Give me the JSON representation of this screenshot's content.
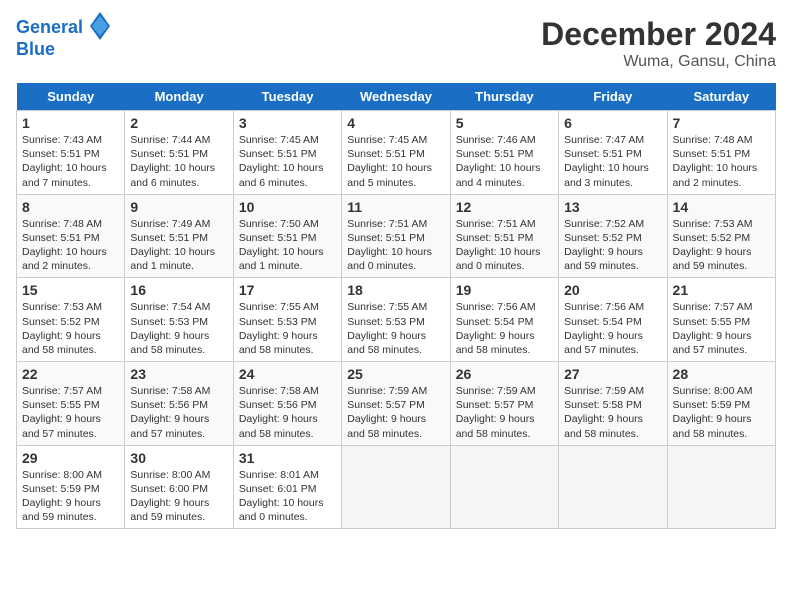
{
  "header": {
    "logo_line1": "General",
    "logo_line2": "Blue",
    "month": "December 2024",
    "location": "Wuma, Gansu, China"
  },
  "days_of_week": [
    "Sunday",
    "Monday",
    "Tuesday",
    "Wednesday",
    "Thursday",
    "Friday",
    "Saturday"
  ],
  "weeks": [
    [
      {
        "day": 1,
        "sunrise": "7:43 AM",
        "sunset": "5:51 PM",
        "daylight": "10 hours and 7 minutes."
      },
      {
        "day": 2,
        "sunrise": "7:44 AM",
        "sunset": "5:51 PM",
        "daylight": "10 hours and 6 minutes."
      },
      {
        "day": 3,
        "sunrise": "7:45 AM",
        "sunset": "5:51 PM",
        "daylight": "10 hours and 6 minutes."
      },
      {
        "day": 4,
        "sunrise": "7:45 AM",
        "sunset": "5:51 PM",
        "daylight": "10 hours and 5 minutes."
      },
      {
        "day": 5,
        "sunrise": "7:46 AM",
        "sunset": "5:51 PM",
        "daylight": "10 hours and 4 minutes."
      },
      {
        "day": 6,
        "sunrise": "7:47 AM",
        "sunset": "5:51 PM",
        "daylight": "10 hours and 3 minutes."
      },
      {
        "day": 7,
        "sunrise": "7:48 AM",
        "sunset": "5:51 PM",
        "daylight": "10 hours and 2 minutes."
      }
    ],
    [
      {
        "day": 8,
        "sunrise": "7:48 AM",
        "sunset": "5:51 PM",
        "daylight": "10 hours and 2 minutes."
      },
      {
        "day": 9,
        "sunrise": "7:49 AM",
        "sunset": "5:51 PM",
        "daylight": "10 hours and 1 minute."
      },
      {
        "day": 10,
        "sunrise": "7:50 AM",
        "sunset": "5:51 PM",
        "daylight": "10 hours and 1 minute."
      },
      {
        "day": 11,
        "sunrise": "7:51 AM",
        "sunset": "5:51 PM",
        "daylight": "10 hours and 0 minutes."
      },
      {
        "day": 12,
        "sunrise": "7:51 AM",
        "sunset": "5:51 PM",
        "daylight": "10 hours and 0 minutes."
      },
      {
        "day": 13,
        "sunrise": "7:52 AM",
        "sunset": "5:52 PM",
        "daylight": "9 hours and 59 minutes."
      },
      {
        "day": 14,
        "sunrise": "7:53 AM",
        "sunset": "5:52 PM",
        "daylight": "9 hours and 59 minutes."
      }
    ],
    [
      {
        "day": 15,
        "sunrise": "7:53 AM",
        "sunset": "5:52 PM",
        "daylight": "9 hours and 58 minutes."
      },
      {
        "day": 16,
        "sunrise": "7:54 AM",
        "sunset": "5:53 PM",
        "daylight": "9 hours and 58 minutes."
      },
      {
        "day": 17,
        "sunrise": "7:55 AM",
        "sunset": "5:53 PM",
        "daylight": "9 hours and 58 minutes."
      },
      {
        "day": 18,
        "sunrise": "7:55 AM",
        "sunset": "5:53 PM",
        "daylight": "9 hours and 58 minutes."
      },
      {
        "day": 19,
        "sunrise": "7:56 AM",
        "sunset": "5:54 PM",
        "daylight": "9 hours and 58 minutes."
      },
      {
        "day": 20,
        "sunrise": "7:56 AM",
        "sunset": "5:54 PM",
        "daylight": "9 hours and 57 minutes."
      },
      {
        "day": 21,
        "sunrise": "7:57 AM",
        "sunset": "5:55 PM",
        "daylight": "9 hours and 57 minutes."
      }
    ],
    [
      {
        "day": 22,
        "sunrise": "7:57 AM",
        "sunset": "5:55 PM",
        "daylight": "9 hours and 57 minutes."
      },
      {
        "day": 23,
        "sunrise": "7:58 AM",
        "sunset": "5:56 PM",
        "daylight": "9 hours and 57 minutes."
      },
      {
        "day": 24,
        "sunrise": "7:58 AM",
        "sunset": "5:56 PM",
        "daylight": "9 hours and 58 minutes."
      },
      {
        "day": 25,
        "sunrise": "7:59 AM",
        "sunset": "5:57 PM",
        "daylight": "9 hours and 58 minutes."
      },
      {
        "day": 26,
        "sunrise": "7:59 AM",
        "sunset": "5:57 PM",
        "daylight": "9 hours and 58 minutes."
      },
      {
        "day": 27,
        "sunrise": "7:59 AM",
        "sunset": "5:58 PM",
        "daylight": "9 hours and 58 minutes."
      },
      {
        "day": 28,
        "sunrise": "8:00 AM",
        "sunset": "5:59 PM",
        "daylight": "9 hours and 58 minutes."
      }
    ],
    [
      {
        "day": 29,
        "sunrise": "8:00 AM",
        "sunset": "5:59 PM",
        "daylight": "9 hours and 59 minutes."
      },
      {
        "day": 30,
        "sunrise": "8:00 AM",
        "sunset": "6:00 PM",
        "daylight": "9 hours and 59 minutes."
      },
      {
        "day": 31,
        "sunrise": "8:01 AM",
        "sunset": "6:01 PM",
        "daylight": "10 hours and 0 minutes."
      },
      null,
      null,
      null,
      null
    ]
  ]
}
